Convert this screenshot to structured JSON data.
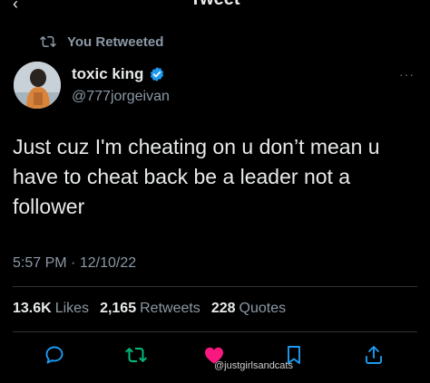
{
  "header": {
    "title": "Tweet",
    "back_icon": "back-arrow-icon"
  },
  "retweet_context": {
    "label": "You Retweeted",
    "icon": "retweet-icon"
  },
  "author": {
    "name": "toxic king",
    "handle": "@777jorgeivan",
    "verified_color": "#1d9bf0"
  },
  "tweet": {
    "text": "Just cuz I'm cheating on u don’t mean u have to cheat back be a leader not a follower",
    "time": "5:57 PM",
    "separator": "·",
    "date": "12/10/22"
  },
  "stats": {
    "likes_count": "13.6K",
    "likes_label": "Likes",
    "retweets_count": "2,165",
    "retweets_label": "Retweets",
    "quotes_count": "228",
    "quotes_label": "Quotes"
  },
  "actions": {
    "reply_icon": "reply-icon",
    "retweet_icon": "retweet-icon",
    "like_icon": "heart-icon",
    "bookmark_icon": "bookmark-icon",
    "share_icon": "share-icon",
    "retweet_active_color": "#00ba7c",
    "like_active_color": "#f91880"
  },
  "watermark": "@justgirlsandcats",
  "colors": {
    "background": "#000000",
    "text": "#e7e9ea",
    "secondary": "#8b98a5"
  }
}
